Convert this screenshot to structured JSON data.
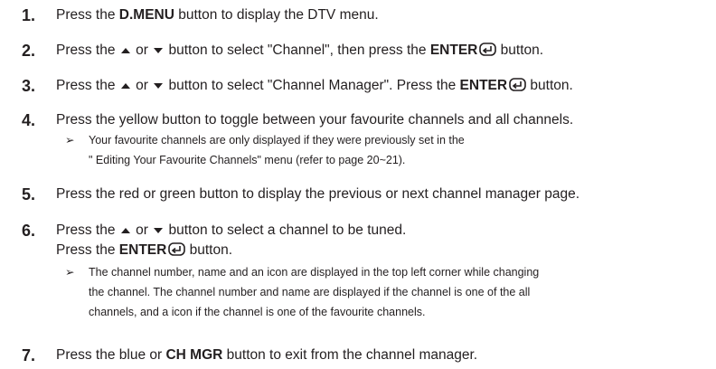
{
  "steps": [
    {
      "num": "1.",
      "a": "Press the ",
      "b": "D.MENU",
      "c": " button to display the DTV menu."
    },
    {
      "num": "2.",
      "a": "Press the ",
      "b": " or ",
      "c": " button to select \"Channel\", then press the ",
      "d": "ENTER",
      "e": " button."
    },
    {
      "num": "3.",
      "a": "Press the ",
      "b": " or ",
      "c": " button to select \"Channel Manager\". Press the ",
      "d": "ENTER",
      "e": " button."
    },
    {
      "num": "4.",
      "text": "Press the yellow button to toggle between your favourite channels and all channels.",
      "note": [
        "Your favourite channels are only displayed if they were previously set in the",
        "\" Editing Your Favourite Channels\" menu (refer to page 20~21)."
      ]
    },
    {
      "num": "5.",
      "text": "Press the red or green button to display the previous or next channel manager page."
    },
    {
      "num": "6.",
      "a": "Press the ",
      "b": " or ",
      "c": " button to select a channel to be tuned.",
      "l2a": "Press the ",
      "l2b": "ENTER",
      "l2c": " button.",
      "note": [
        "The channel number, name and an icon are displayed in the top left corner while changing",
        "the channel. The channel number and name are displayed if the channel is one of the all",
        "channels, and a  icon if the channel is one of the favourite channels."
      ]
    },
    {
      "num": "7.",
      "a": "Press the blue or ",
      "b": "CH MGR",
      "c": " button to exit from the channel manager."
    }
  ],
  "note_marker": "➢",
  "colors": {
    "text": "#231f20"
  },
  "icons": {
    "up": "up-arrow-icon",
    "down": "down-arrow-icon",
    "enter": "enter-icon"
  }
}
